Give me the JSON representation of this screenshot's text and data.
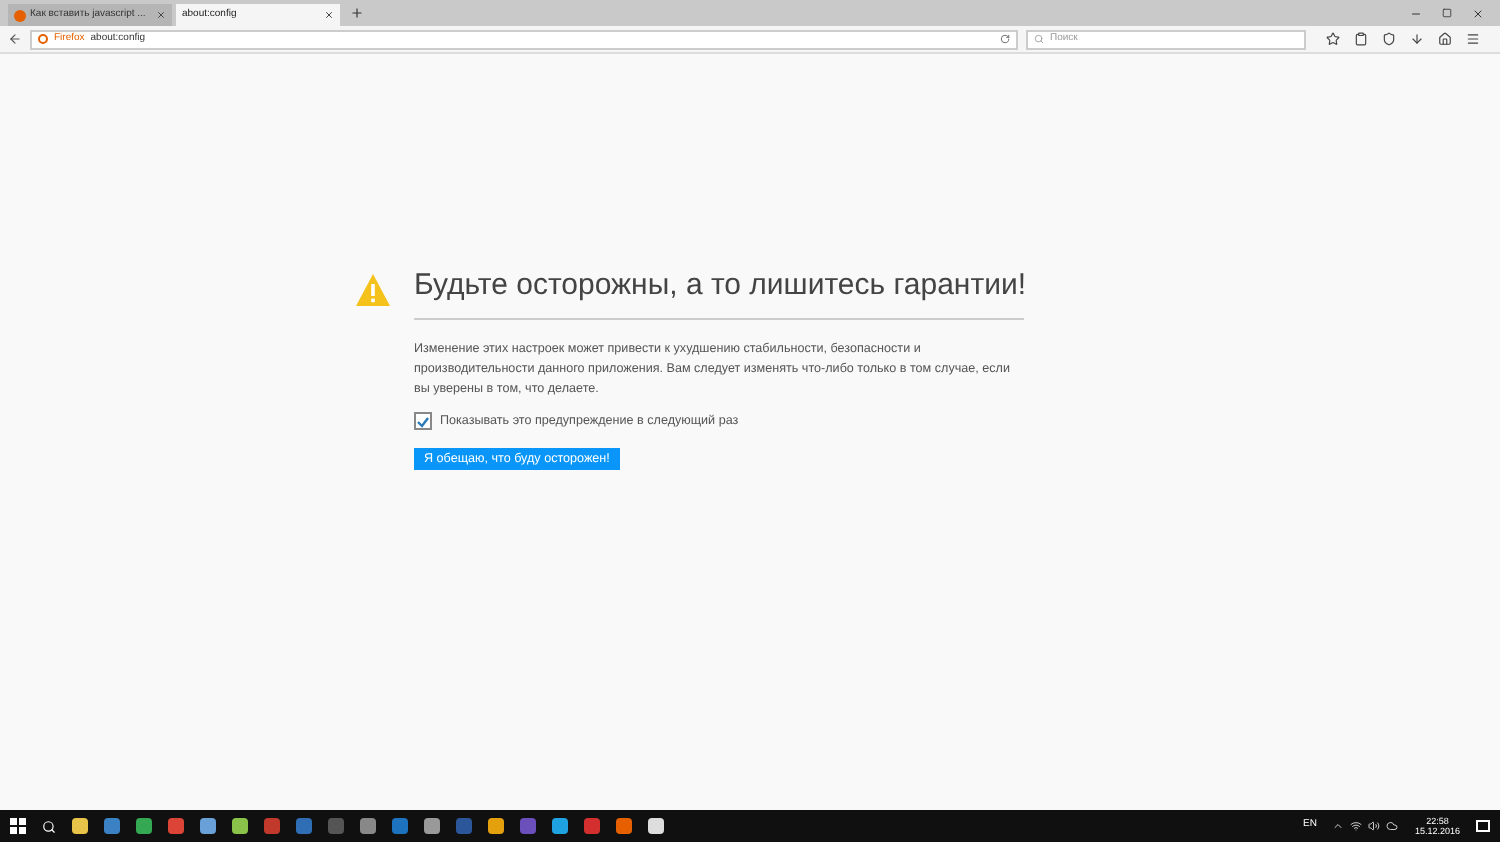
{
  "tabs": [
    {
      "label": "Как вставить javascript ...",
      "selected": false
    },
    {
      "label": "about:config",
      "selected": true
    }
  ],
  "address_bar": {
    "identity": "Firefox",
    "value": "about:config"
  },
  "search": {
    "placeholder": "Поиск"
  },
  "warning": {
    "title": "Будьте осторожны, а то лишитесь гарантии!",
    "text": "Изменение этих настроек может привести к ухудшению стабильности, безопасности и производительности данного приложения. Вам следует изменять что-либо только в том случае, если вы уверены в том, что делаете.",
    "checkbox": {
      "label": "Показывать это предупреждение в следующий раз",
      "checked": true
    },
    "button": "Я обещаю, что буду осторожен!"
  },
  "taskbar": {
    "language": "EN",
    "time": "22:58",
    "date": "15.12.2016"
  }
}
